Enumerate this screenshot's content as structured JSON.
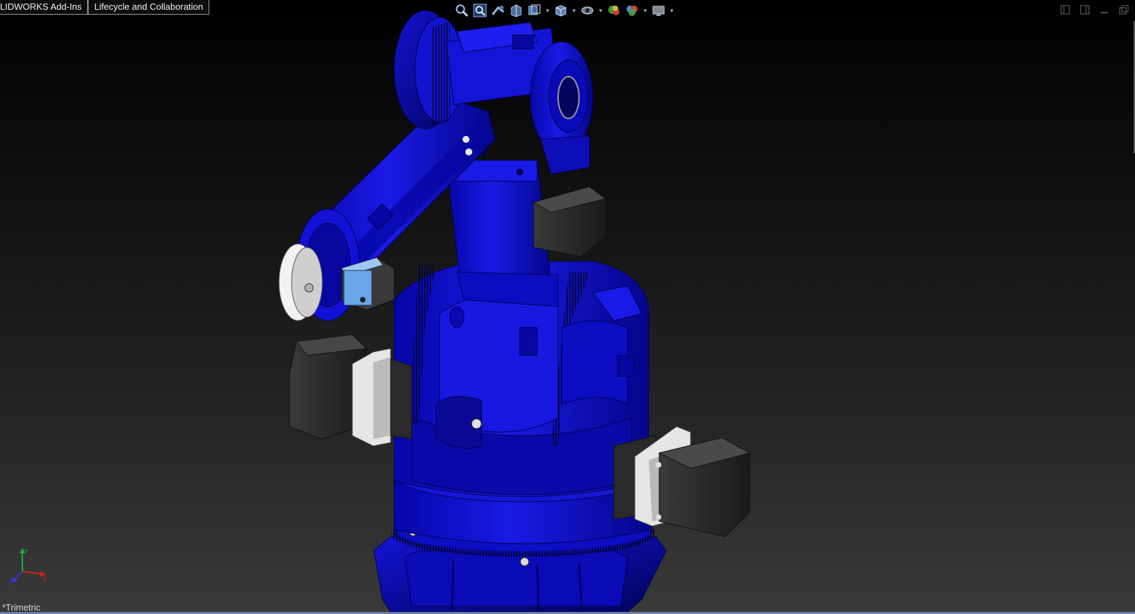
{
  "tabs": [
    {
      "label": "LIDWORKS Add-Ins"
    },
    {
      "label": "Lifecycle and Collaboration"
    }
  ],
  "heads_up_toolbar": [
    {
      "icon": "zoom-to-fit-icon"
    },
    {
      "icon": "zoom-to-area-icon"
    },
    {
      "icon": "previous-view-icon"
    },
    {
      "icon": "section-view-icon"
    },
    {
      "icon": "dynamic-annotation-views-icon"
    },
    {
      "icon": "view-orientation-icon"
    },
    {
      "icon": "display-style-icon"
    },
    {
      "icon": "hide-show-items-icon"
    },
    {
      "icon": "edit-appearance-icon"
    },
    {
      "icon": "apply-scene-icon"
    },
    {
      "icon": "view-settings-icon"
    }
  ],
  "window_controls": [
    "tile-left-icon",
    "tile-right-icon",
    "minimize-icon",
    "restore-icon"
  ],
  "viewport": {
    "view_label": "*Trimetric",
    "model_color": "#0a0ad8",
    "motor_color": "#2b2b2b",
    "accent_color": "#6aa7e8"
  }
}
